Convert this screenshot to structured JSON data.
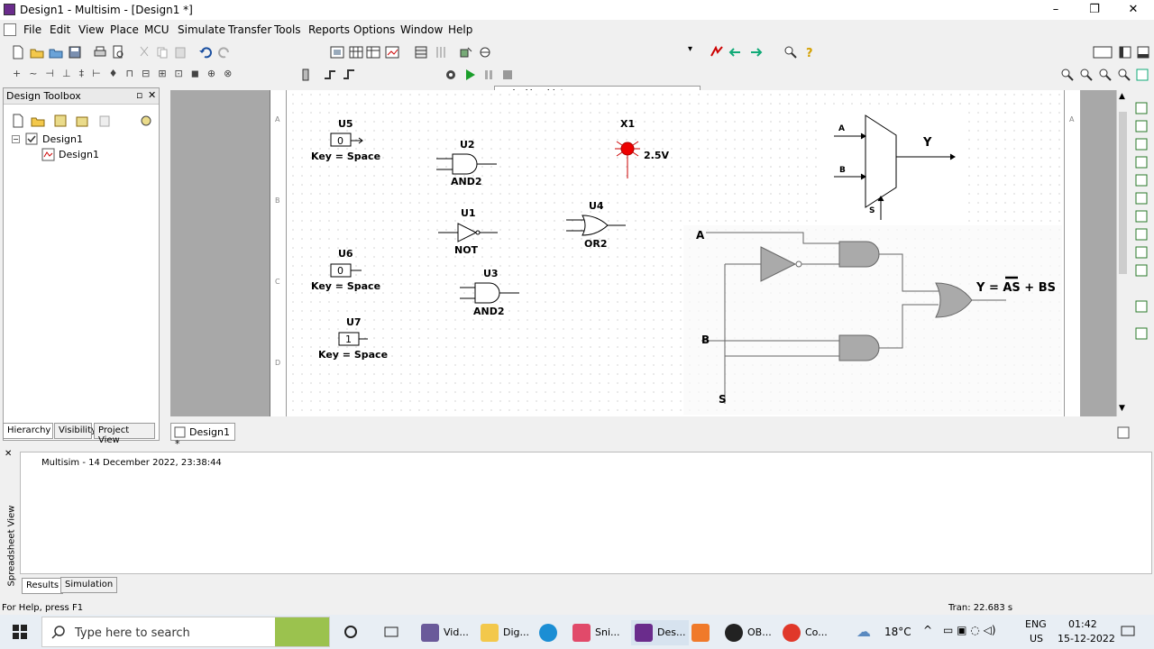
{
  "window": {
    "title": "Design1 - Multisim - [Design1 *]",
    "minimize": "–",
    "maximize": "❐",
    "close": "✕"
  },
  "menu": [
    "File",
    "Edit",
    "View",
    "Place",
    "MCU",
    "Simulate",
    "Transfer",
    "Tools",
    "Reports",
    "Options",
    "Window",
    "Help"
  ],
  "toolbar": {
    "in_use_list": "--- In-Use List ---"
  },
  "toolbox": {
    "title": "Design Toolbox",
    "tree_root": "Design1",
    "tree_child": "Design1",
    "tabs": [
      "Hierarchy",
      "Visibility",
      "Project View"
    ]
  },
  "document_tab": "Design1 *",
  "schematic": {
    "u5": {
      "ref": "U5",
      "value": "0",
      "label": "Key = Space"
    },
    "u6": {
      "ref": "U6",
      "value": "0",
      "label": "Key = Space"
    },
    "u7": {
      "ref": "U7",
      "value": "1",
      "label": "Key = Space"
    },
    "u2": {
      "ref": "U2",
      "type": "AND2"
    },
    "u1": {
      "ref": "U1",
      "type": "NOT"
    },
    "u3": {
      "ref": "U3",
      "type": "AND2"
    },
    "u4": {
      "ref": "U4",
      "type": "OR2"
    },
    "x1": {
      "ref": "X1",
      "value": "2.5V"
    },
    "mux": {
      "a": "A",
      "b": "B",
      "s": "S",
      "y": "Y"
    },
    "circuit": {
      "a": "A",
      "b": "B",
      "s": "S",
      "equation": "Y = AS + BS"
    },
    "border_letters": [
      "A",
      "B",
      "C",
      "D"
    ]
  },
  "output": {
    "log": "Multisim  -  14 December 2022, 23:38:44",
    "tabs": [
      "Results",
      "Simulation"
    ],
    "side_label": "Spreadsheet View"
  },
  "status": {
    "help": "For Help, press F1",
    "tran": "Tran: 22.683 s"
  },
  "taskbar": {
    "search": "Type here to search",
    "apps": [
      "Vid...",
      "Dig...",
      "Sni...",
      "Des...",
      "OB...",
      "Co..."
    ],
    "weather": "18°C",
    "lang": "ENG",
    "region": "US",
    "time": "01:42",
    "date": "15-12-2022"
  }
}
